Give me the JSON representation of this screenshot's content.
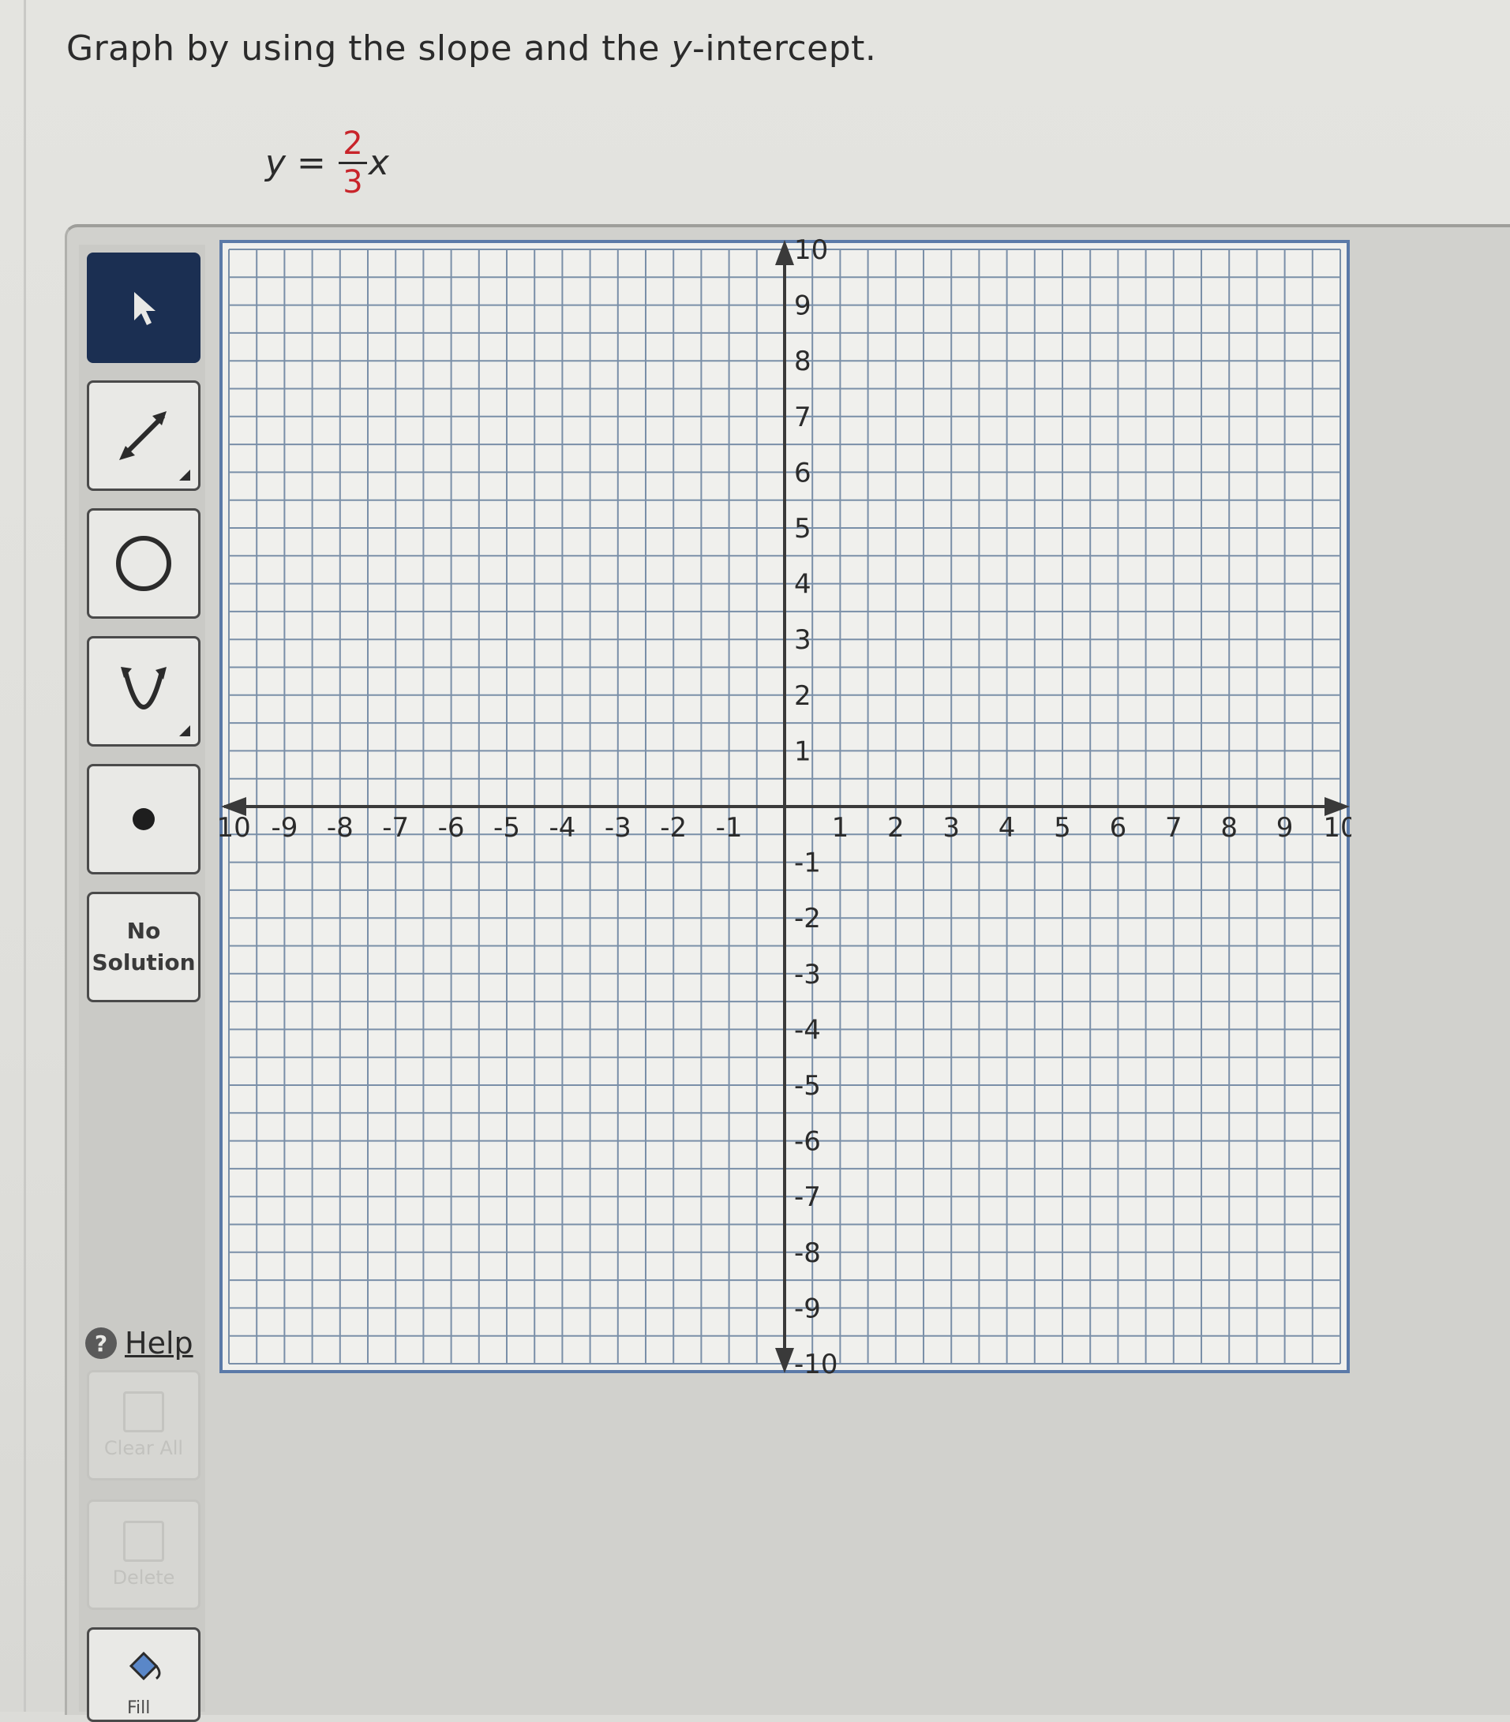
{
  "question": {
    "instruction_pre": "Graph by using the slope and the ",
    "instruction_var": "y",
    "instruction_post": "-intercept.",
    "equation_lhs": "y",
    "equation_eq": "=",
    "fraction_numerator": "2",
    "fraction_denominator": "3",
    "equation_var": "x"
  },
  "toolbar": {
    "no_solution_line1": "No",
    "no_solution_line2": "Solution",
    "help_label": "Help",
    "help_glyph": "?",
    "clear_all_label": "Clear All",
    "delete_label": "Delete",
    "fill_label": "Fill"
  },
  "graph": {
    "x_range": [
      -10,
      10
    ],
    "y_range": [
      -10,
      10
    ],
    "grid_step": 0.5,
    "x_tick_labels": [
      "-10",
      "-9",
      "-8",
      "-7",
      "-6",
      "-5",
      "-4",
      "-3",
      "-2",
      "-1",
      "1",
      "2",
      "3",
      "4",
      "5",
      "6",
      "7",
      "8",
      "9",
      "10"
    ],
    "y_tick_labels": [
      "10",
      "9",
      "8",
      "7",
      "6",
      "5",
      "4",
      "3",
      "2",
      "1",
      "-1",
      "-2",
      "-3",
      "-4",
      "-5",
      "-6",
      "-7",
      "-8",
      "-9",
      "-10"
    ],
    "colors": {
      "grid": "#7a8fa8",
      "axis": "#3a3a3a",
      "border": "#5b7aa8",
      "background": "#f0f0ed"
    }
  }
}
